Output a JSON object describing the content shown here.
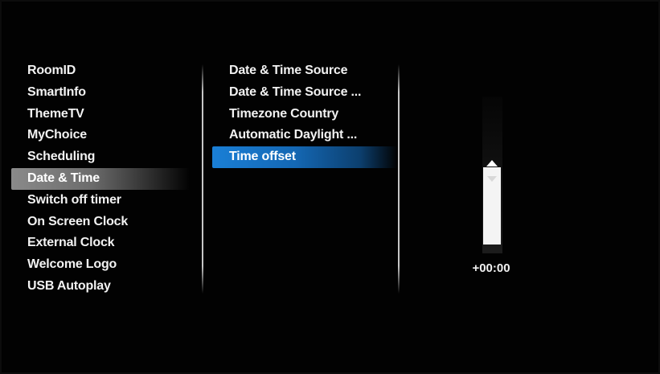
{
  "left_menu": {
    "items": [
      {
        "label": "RoomID"
      },
      {
        "label": "SmartInfo"
      },
      {
        "label": "ThemeTV"
      },
      {
        "label": "MyChoice"
      },
      {
        "label": "Scheduling"
      },
      {
        "label": "Date & Time"
      },
      {
        "label": "Switch off timer"
      },
      {
        "label": "On Screen Clock"
      },
      {
        "label": "External Clock"
      },
      {
        "label": "Welcome Logo"
      },
      {
        "label": "USB Autoplay"
      }
    ],
    "selected_label": "Date & Time"
  },
  "sub_menu": {
    "items": [
      {
        "label": "Date & Time Source"
      },
      {
        "label": "Date & Time Source ..."
      },
      {
        "label": "Timezone Country"
      },
      {
        "label": "Automatic Daylight ..."
      },
      {
        "label": "Time offset"
      }
    ],
    "selected_label": "Time offset"
  },
  "slider": {
    "value_text": "+00:00",
    "level": 0.5
  },
  "colors": {
    "left_highlight": "#7a7a7a",
    "sub_highlight": "#1a7fd6",
    "text": "#f2f2f2",
    "background": "#020202"
  }
}
